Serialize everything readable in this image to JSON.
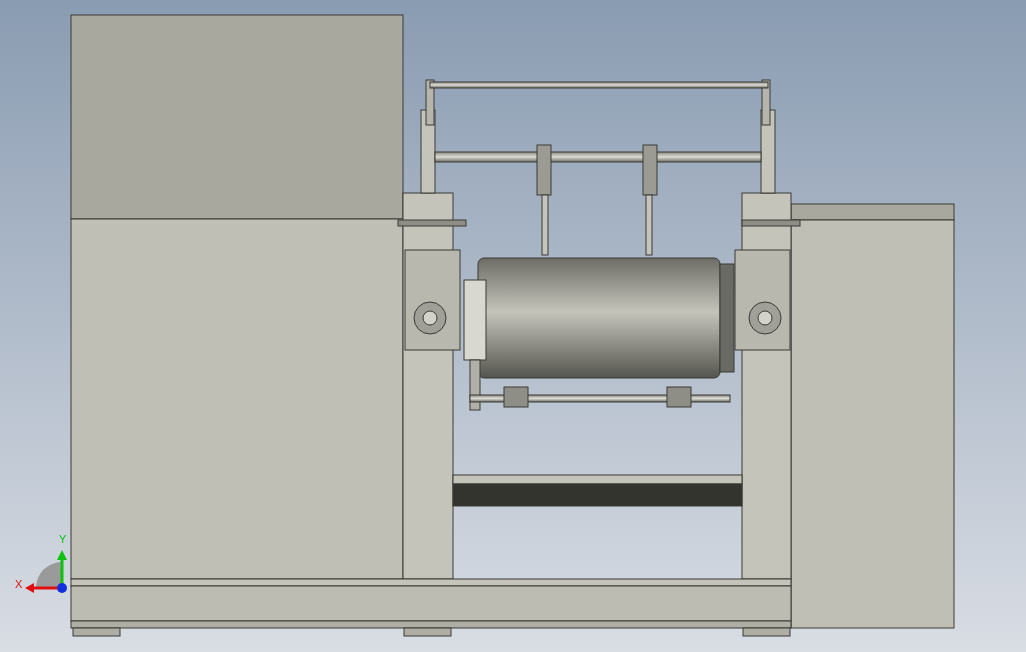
{
  "viewport": {
    "triad": {
      "x_label": "X",
      "y_label": "Y"
    }
  }
}
